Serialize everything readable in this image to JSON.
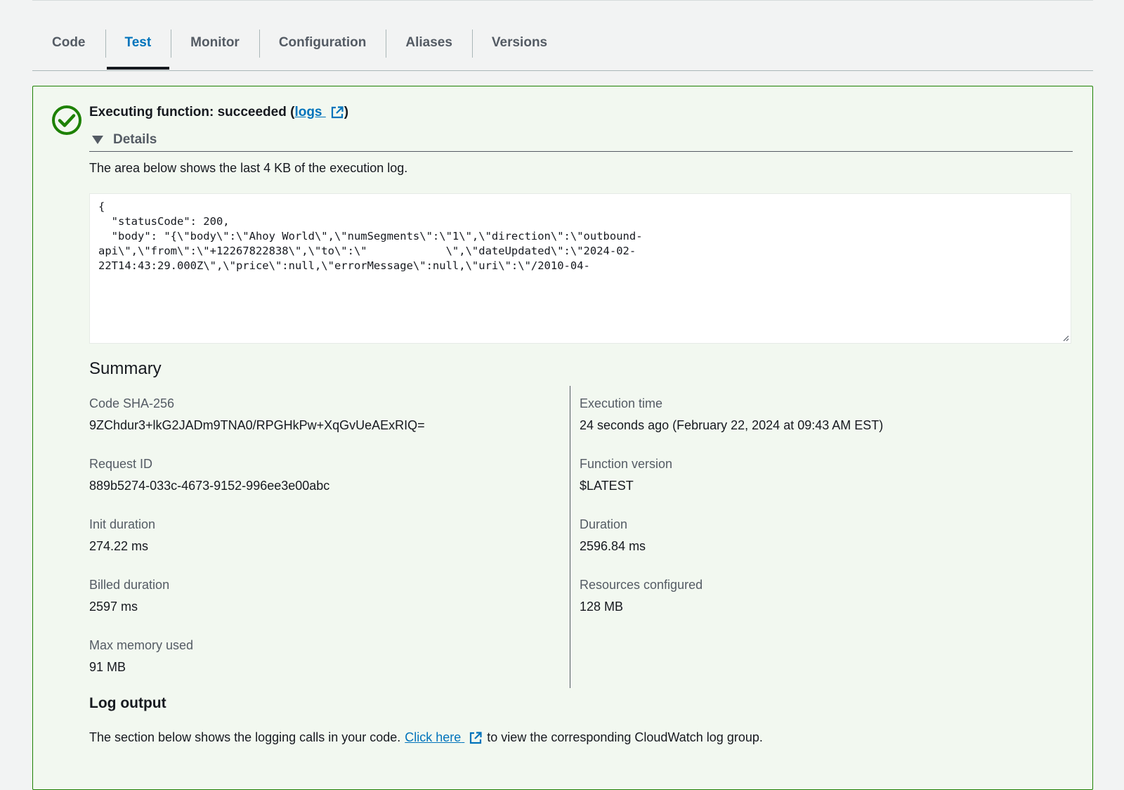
{
  "tabs": [
    {
      "label": "Code",
      "active": false
    },
    {
      "label": "Test",
      "active": true
    },
    {
      "label": "Monitor",
      "active": false
    },
    {
      "label": "Configuration",
      "active": false
    },
    {
      "label": "Aliases",
      "active": false
    },
    {
      "label": "Versions",
      "active": false
    }
  ],
  "result": {
    "status_prefix": "Executing function: succeeded (",
    "logs_link": "logs",
    "status_suffix": ")",
    "details_label": "Details",
    "description": "The area below shows the last 4 KB of the execution log.",
    "log_text": "{\n  \"statusCode\": 200,\n  \"body\": \"{\\\"body\\\":\\\"Ahoy World\\\",\\\"numSegments\\\":\\\"1\\\",\\\"direction\\\":\\\"outbound-\napi\\\",\\\"from\\\":\\\"+12267822838\\\",\\\"to\\\":\\\"            \\\",\\\"dateUpdated\\\":\\\"2024-02-\n22T14:43:29.000Z\\\",\\\"price\\\":null,\\\"errorMessage\\\":null,\\\"uri\\\":\\\"/2010-04-"
  },
  "summary": {
    "title": "Summary",
    "left": [
      {
        "label": "Code SHA-256",
        "value": "9ZChdur3+lkG2JADm9TNA0/RPGHkPw+XqGvUeAExRIQ="
      },
      {
        "label": "Request ID",
        "value": "889b5274-033c-4673-9152-996ee3e00abc"
      },
      {
        "label": "Init duration",
        "value": "274.22 ms"
      },
      {
        "label": "Billed duration",
        "value": "2597 ms"
      },
      {
        "label": "Max memory used",
        "value": "91 MB"
      }
    ],
    "right": [
      {
        "label": "Execution time",
        "value": "24 seconds ago (February 22, 2024 at 09:43 AM EST)"
      },
      {
        "label": "Function version",
        "value": "$LATEST"
      },
      {
        "label": "Duration",
        "value": "2596.84 ms"
      },
      {
        "label": "Resources configured",
        "value": "128 MB"
      }
    ]
  },
  "log_output": {
    "title": "Log output",
    "desc_before": "The section below shows the logging calls in your code.",
    "link": "Click here",
    "desc_after": "to view the corresponding CloudWatch log group."
  },
  "colors": {
    "success": "#1d8102",
    "link": "#0073bb",
    "panel_bg": "#f2f8f0",
    "page_bg": "#f2f3f3"
  },
  "icons": [
    "success-check-icon",
    "external-link-icon",
    "caret-down-icon",
    "resize-grip-icon"
  ]
}
